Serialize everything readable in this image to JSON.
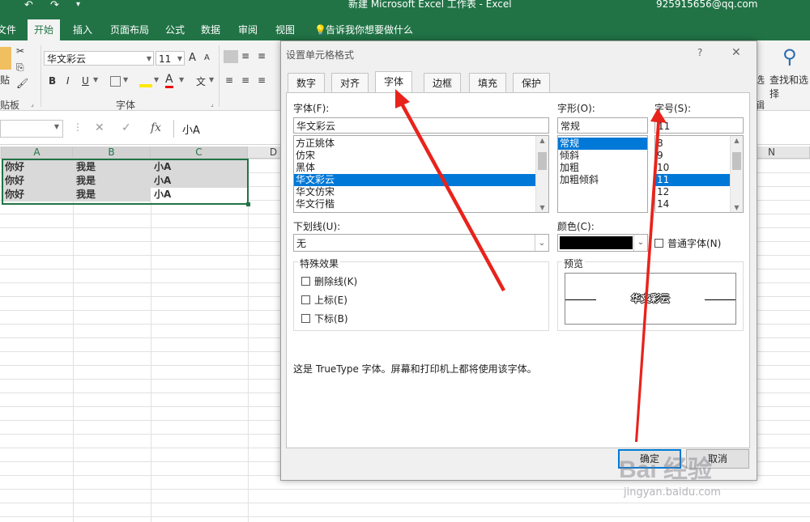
{
  "window": {
    "title": "新建 Microsoft Excel 工作表 - Excel",
    "account": "925915656@qq.com"
  },
  "ribbon": {
    "tabs": [
      "文件",
      "开始",
      "插入",
      "页面布局",
      "公式",
      "数据",
      "审阅",
      "视图"
    ],
    "active_tab": "开始",
    "tell_me": "告诉我你想要做什么",
    "font_name": "华文彩云",
    "font_size": "11",
    "paste_label": "贴",
    "clipboard_group": "贴板",
    "font_group": "字体",
    "bold": "B",
    "italic": "I",
    "underline": "U",
    "font_color_glyph": "A",
    "grow_font": "A",
    "shrink_font": "A",
    "phonetic": "文",
    "select_label": "选",
    "find_select_label": "查找和选择",
    "edit_group": "辑"
  },
  "formula_bar": {
    "cancel": "✕",
    "enter": "✓",
    "fx": "fx",
    "content": "小A"
  },
  "sheet": {
    "columns": [
      "A",
      "B",
      "C",
      "D",
      "N"
    ],
    "rows": [
      [
        "你好",
        "我是",
        "小A"
      ],
      [
        "你好",
        "我是",
        "小A"
      ],
      [
        "你好",
        "我是",
        "小A"
      ]
    ]
  },
  "dialog": {
    "title": "设置单元格格式",
    "help": "?",
    "close": "✕",
    "tabs": [
      "数字",
      "对齐",
      "字体",
      "边框",
      "填充",
      "保护"
    ],
    "active_tab": "字体",
    "font_label": "字体(F):",
    "font_value": "华文彩云",
    "font_list": [
      "方正姚体",
      "仿宋",
      "黑体",
      "华文彩云",
      "华文仿宋",
      "华文行楷"
    ],
    "font_selected": "华文彩云",
    "style_label": "字形(O):",
    "style_value": "常规",
    "style_list": [
      "常规",
      "倾斜",
      "加粗",
      "加粗倾斜"
    ],
    "style_selected": "常规",
    "size_label": "字号(S):",
    "size_value": "11",
    "size_list": [
      "8",
      "9",
      "10",
      "11",
      "12",
      "14"
    ],
    "size_selected": "11",
    "underline_label": "下划线(U):",
    "underline_value": "无",
    "color_label": "颜色(C):",
    "color_value": "#000000",
    "normal_font_label": "普通字体(N)",
    "effects_label": "特殊效果",
    "strikethrough_label": "删除线(K)",
    "superscript_label": "上标(E)",
    "subscript_label": "下标(B)",
    "preview_label": "预览",
    "preview_text": "华文彩云",
    "info_text": "这是 TrueType 字体。屏幕和打印机上都将使用该字体。",
    "ok_label": "确定",
    "cancel_label": "取消"
  },
  "watermark": {
    "brand": "Bai 经验",
    "url": "jingyan.baidu.com"
  },
  "colors": {
    "excel_green": "#217346",
    "selection_blue": "#0078d7",
    "annotation_red": "#e8231c"
  }
}
